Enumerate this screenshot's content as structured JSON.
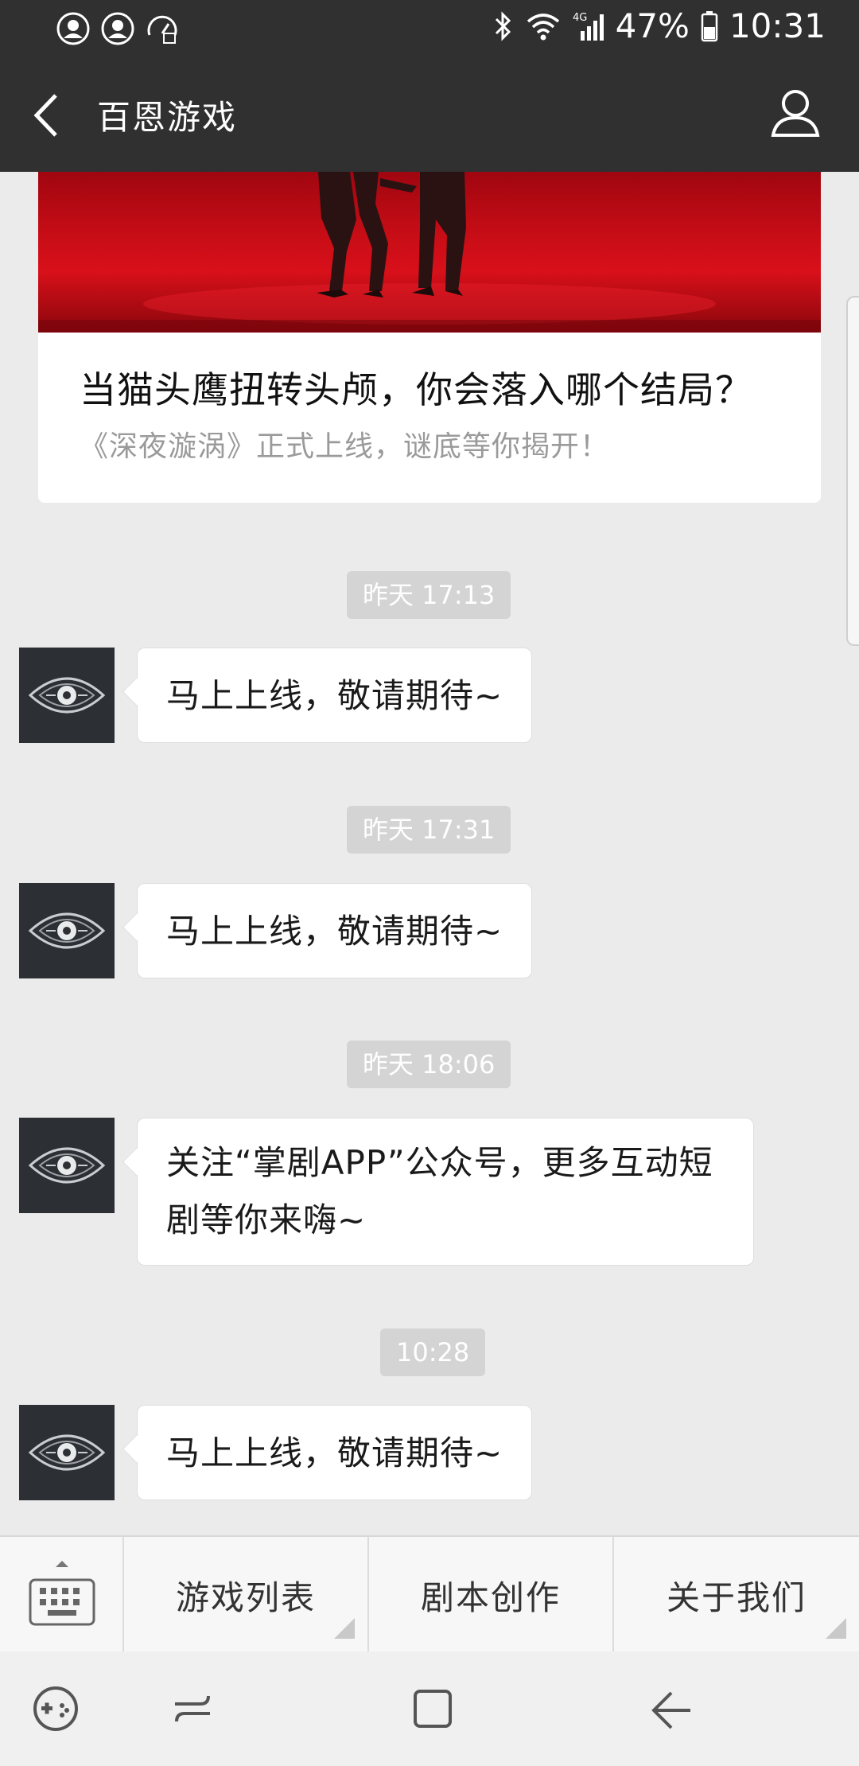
{
  "status_bar": {
    "battery": "47%",
    "time": "10:31",
    "network": "4G",
    "icons": [
      "notification-icon",
      "notification-icon",
      "speed-icon",
      "bluetooth-icon",
      "wifi-icon",
      "signal-icon",
      "battery-icon"
    ]
  },
  "header": {
    "title": "百恩游戏",
    "back_icon": "back-arrow-icon",
    "profile_icon": "person-icon"
  },
  "article": {
    "title": "当猫头鹰扭转头颅，你会落入哪个结局？",
    "description": "《深夜漩涡》正式上线，谜底等你揭开！"
  },
  "messages": [
    {
      "time": "昨天 17:13",
      "text": "马上上线，敬请期待~"
    },
    {
      "time": "昨天 17:31",
      "text": "马上上线，敬请期待~"
    },
    {
      "time": "昨天 18:06",
      "text": "关注“掌剧APP”公众号，更多互动短剧等你来嗨~"
    },
    {
      "time": "10:28",
      "text": "马上上线，敬请期待~"
    }
  ],
  "menu": {
    "keyboard_icon": "keyboard-icon",
    "items": [
      "游戏列表",
      "剧本创作",
      "关于我们"
    ]
  },
  "nav_bar": {
    "icons": [
      "game-launcher-icon",
      "recent-apps-icon",
      "home-icon",
      "back-icon"
    ]
  },
  "colors": {
    "header_bg": "#303030",
    "chat_bg": "#ebebeb",
    "article_image": "#c80d16",
    "time_pill": "#d4d4d4"
  }
}
